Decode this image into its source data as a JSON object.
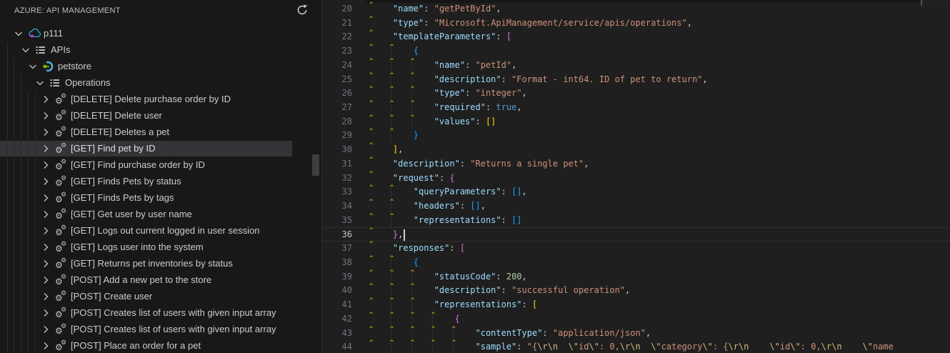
{
  "sidebar": {
    "title": "AZURE: API MANAGEMENT",
    "refresh_tooltip": "Refresh",
    "tree": [
      {
        "label": "p111",
        "level": 0,
        "icon": "azure-cloud-icon",
        "chevron": "expanded",
        "selected": false
      },
      {
        "label": "APIs",
        "level": 1,
        "icon": "list-icon",
        "chevron": "expanded",
        "selected": false
      },
      {
        "label": "petstore",
        "level": 2,
        "icon": "api-icon",
        "chevron": "expanded",
        "selected": false
      },
      {
        "label": "Operations",
        "level": 3,
        "icon": "list-icon",
        "chevron": "expanded",
        "selected": false
      },
      {
        "label": "[DELETE] Delete purchase order by ID",
        "level": 4,
        "icon": "gears-icon",
        "chevron": "collapsed",
        "selected": false
      },
      {
        "label": "[DELETE] Delete user",
        "level": 4,
        "icon": "gears-icon",
        "chevron": "collapsed",
        "selected": false
      },
      {
        "label": "[DELETE] Deletes a pet",
        "level": 4,
        "icon": "gears-icon",
        "chevron": "collapsed",
        "selected": false
      },
      {
        "label": "[GET] Find pet by ID",
        "level": 4,
        "icon": "gears-icon",
        "chevron": "collapsed",
        "selected": true
      },
      {
        "label": "[GET] Find purchase order by ID",
        "level": 4,
        "icon": "gears-icon",
        "chevron": "collapsed",
        "selected": false
      },
      {
        "label": "[GET] Finds Pets by status",
        "level": 4,
        "icon": "gears-icon",
        "chevron": "collapsed",
        "selected": false
      },
      {
        "label": "[GET] Finds Pets by tags",
        "level": 4,
        "icon": "gears-icon",
        "chevron": "collapsed",
        "selected": false
      },
      {
        "label": "[GET] Get user by user name",
        "level": 4,
        "icon": "gears-icon",
        "chevron": "collapsed",
        "selected": false
      },
      {
        "label": "[GET] Logs out current logged in user session",
        "level": 4,
        "icon": "gears-icon",
        "chevron": "collapsed",
        "selected": false
      },
      {
        "label": "[GET] Logs user into the system",
        "level": 4,
        "icon": "gears-icon",
        "chevron": "collapsed",
        "selected": false
      },
      {
        "label": "[GET] Returns pet inventories by status",
        "level": 4,
        "icon": "gears-icon",
        "chevron": "collapsed",
        "selected": false
      },
      {
        "label": "[POST] Add a new pet to the store",
        "level": 4,
        "icon": "gears-icon",
        "chevron": "collapsed",
        "selected": false
      },
      {
        "label": "[POST] Create user",
        "level": 4,
        "icon": "gears-icon",
        "chevron": "collapsed",
        "selected": false
      },
      {
        "label": "[POST] Creates list of users with given input array",
        "level": 4,
        "icon": "gears-icon",
        "chevron": "collapsed",
        "selected": false
      },
      {
        "label": "[POST] Creates list of users with given input array",
        "level": 4,
        "icon": "gears-icon",
        "chevron": "collapsed",
        "selected": false
      },
      {
        "label": "[POST] Place an order for a pet",
        "level": 4,
        "icon": "gears-icon",
        "chevron": "collapsed",
        "selected": false
      }
    ]
  },
  "editor": {
    "language": "json",
    "cursor_line": 36,
    "lines": [
      {
        "n": 20,
        "indent": 1,
        "tokens": [
          [
            "k",
            "\"name\""
          ],
          [
            "p",
            ": "
          ],
          [
            "s",
            "\"getPetById\""
          ],
          [
            "p",
            ","
          ]
        ]
      },
      {
        "n": 21,
        "indent": 1,
        "tokens": [
          [
            "k",
            "\"type\""
          ],
          [
            "p",
            ": "
          ],
          [
            "s",
            "\"Microsoft.ApiManagement/service/apis/operations\""
          ],
          [
            "p",
            ","
          ]
        ]
      },
      {
        "n": 22,
        "indent": 1,
        "tokens": [
          [
            "k",
            "\"templateParameters\""
          ],
          [
            "p",
            ": "
          ],
          [
            "m",
            "["
          ]
        ]
      },
      {
        "n": 23,
        "indent": 2,
        "tokens": [
          [
            "u",
            "{"
          ]
        ]
      },
      {
        "n": 24,
        "indent": 3,
        "tokens": [
          [
            "k",
            "\"name\""
          ],
          [
            "p",
            ": "
          ],
          [
            "s",
            "\"petId\""
          ],
          [
            "p",
            ","
          ]
        ]
      },
      {
        "n": 25,
        "indent": 3,
        "tokens": [
          [
            "k",
            "\"description\""
          ],
          [
            "p",
            ": "
          ],
          [
            "s",
            "\"Format - int64. ID of pet to return\""
          ],
          [
            "p",
            ","
          ]
        ]
      },
      {
        "n": 26,
        "indent": 3,
        "tokens": [
          [
            "k",
            "\"type\""
          ],
          [
            "p",
            ": "
          ],
          [
            "s",
            "\"integer\""
          ],
          [
            "p",
            ","
          ]
        ]
      },
      {
        "n": 27,
        "indent": 3,
        "tokens": [
          [
            "k",
            "\"required\""
          ],
          [
            "p",
            ": "
          ],
          [
            "b",
            "true"
          ],
          [
            "p",
            ","
          ]
        ]
      },
      {
        "n": 28,
        "indent": 3,
        "tokens": [
          [
            "k",
            "\"values\""
          ],
          [
            "p",
            ": "
          ],
          [
            "g",
            "[]"
          ]
        ]
      },
      {
        "n": 29,
        "indent": 2,
        "tokens": [
          [
            "u",
            "}"
          ]
        ]
      },
      {
        "n": 30,
        "indent": 1,
        "tokens": [
          [
            "g",
            "]"
          ],
          [
            "p",
            ","
          ]
        ]
      },
      {
        "n": 31,
        "indent": 1,
        "tokens": [
          [
            "k",
            "\"description\""
          ],
          [
            "p",
            ": "
          ],
          [
            "s",
            "\"Returns a single pet\""
          ],
          [
            "p",
            ","
          ]
        ]
      },
      {
        "n": 32,
        "indent": 1,
        "tokens": [
          [
            "k",
            "\"request\""
          ],
          [
            "p",
            ": "
          ],
          [
            "m",
            "{"
          ]
        ]
      },
      {
        "n": 33,
        "indent": 2,
        "tokens": [
          [
            "k",
            "\"queryParameters\""
          ],
          [
            "p",
            ": "
          ],
          [
            "u",
            "[]"
          ],
          [
            "p",
            ","
          ]
        ]
      },
      {
        "n": 34,
        "indent": 2,
        "tokens": [
          [
            "k",
            "\"headers\""
          ],
          [
            "p",
            ": "
          ],
          [
            "u",
            "[]"
          ],
          [
            "p",
            ","
          ]
        ]
      },
      {
        "n": 35,
        "indent": 2,
        "tokens": [
          [
            "k",
            "\"representations\""
          ],
          [
            "p",
            ": "
          ],
          [
            "u",
            "[]"
          ]
        ]
      },
      {
        "n": 36,
        "indent": 1,
        "tokens": [
          [
            "m",
            "}"
          ],
          [
            "p",
            ","
          ]
        ]
      },
      {
        "n": 37,
        "indent": 1,
        "tokens": [
          [
            "k",
            "\"responses\""
          ],
          [
            "p",
            ": "
          ],
          [
            "m",
            "["
          ]
        ]
      },
      {
        "n": 38,
        "indent": 2,
        "tokens": [
          [
            "u",
            "{"
          ]
        ]
      },
      {
        "n": 39,
        "indent": 3,
        "tokens": [
          [
            "k",
            "\"statusCode\""
          ],
          [
            "p",
            ": "
          ],
          [
            "n",
            "200"
          ],
          [
            "p",
            ","
          ]
        ]
      },
      {
        "n": 40,
        "indent": 3,
        "tokens": [
          [
            "k",
            "\"description\""
          ],
          [
            "p",
            ": "
          ],
          [
            "s",
            "\"successful operation\""
          ],
          [
            "p",
            ","
          ]
        ]
      },
      {
        "n": 41,
        "indent": 3,
        "tokens": [
          [
            "k",
            "\"representations\""
          ],
          [
            "p",
            ": "
          ],
          [
            "g",
            "["
          ]
        ]
      },
      {
        "n": 42,
        "indent": 4,
        "tokens": [
          [
            "m",
            "{"
          ]
        ]
      },
      {
        "n": 43,
        "indent": 5,
        "tokens": [
          [
            "k",
            "\"contentType\""
          ],
          [
            "p",
            ": "
          ],
          [
            "s",
            "\"application/json\""
          ],
          [
            "p",
            ","
          ]
        ]
      },
      {
        "n": 44,
        "indent": 5,
        "tokens": [
          [
            "k",
            "\"sample\""
          ],
          [
            "p",
            ": "
          ],
          [
            "s",
            "\"{"
          ],
          [
            "e",
            "\\r\\n"
          ],
          [
            "s",
            "  "
          ],
          [
            "e",
            "\\\""
          ],
          [
            "s",
            "id"
          ],
          [
            "e",
            "\\\""
          ],
          [
            "s",
            ": 0,"
          ],
          [
            "e",
            "\\r\\n"
          ],
          [
            "s",
            "  "
          ],
          [
            "e",
            "\\\""
          ],
          [
            "s",
            "category"
          ],
          [
            "e",
            "\\\""
          ],
          [
            "s",
            ": {"
          ],
          [
            "e",
            "\\r\\n"
          ],
          [
            "s",
            "    "
          ],
          [
            "e",
            "\\\""
          ],
          [
            "s",
            "id"
          ],
          [
            "e",
            "\\\""
          ],
          [
            "s",
            ": 0,"
          ],
          [
            "e",
            "\\r\\n"
          ],
          [
            "s",
            "    "
          ],
          [
            "e",
            "\\\""
          ],
          [
            "s",
            "name"
          ]
        ]
      }
    ]
  },
  "colors": {
    "sidebar_bg": "#181818",
    "editor_bg": "#1f1f1f",
    "selection_bg": "#343438",
    "json_key": "#9cdcfe",
    "json_string": "#ce9178",
    "json_escape": "#d7ba7d",
    "json_number": "#b5cea8",
    "json_boolean": "#569cd6",
    "bracket_gold": "#ffd700",
    "bracket_magenta": "#da70d6",
    "bracket_blue": "#179fff",
    "line_number": "#6e7681",
    "line_number_active": "#c6c6c6",
    "indent_caret_mark": "#c09a17"
  }
}
